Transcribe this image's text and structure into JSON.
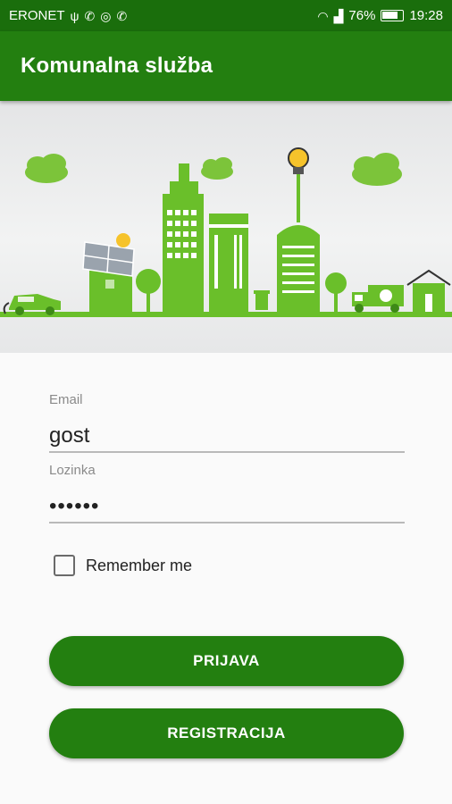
{
  "status_bar": {
    "carrier": "ERONET",
    "battery": "76%",
    "time": "19:28",
    "icons": [
      "usb-icon",
      "viber-icon",
      "instagram-icon",
      "whatsapp-icon",
      "wifi-icon",
      "signal-icon",
      "battery-icon"
    ]
  },
  "app_bar": {
    "title": "Komunalna služba"
  },
  "login": {
    "email_label": "Email",
    "email_value": "gost",
    "password_label": "Lozinka",
    "password_value": "••••••",
    "remember_label": "Remember me",
    "remember_checked": false,
    "login_button": "PRIJAVA",
    "register_button": "REGISTRACIJA"
  },
  "colors": {
    "primary": "#237f10",
    "status_bar": "#1a6e0c",
    "illustration_green": "#6abf2a"
  }
}
